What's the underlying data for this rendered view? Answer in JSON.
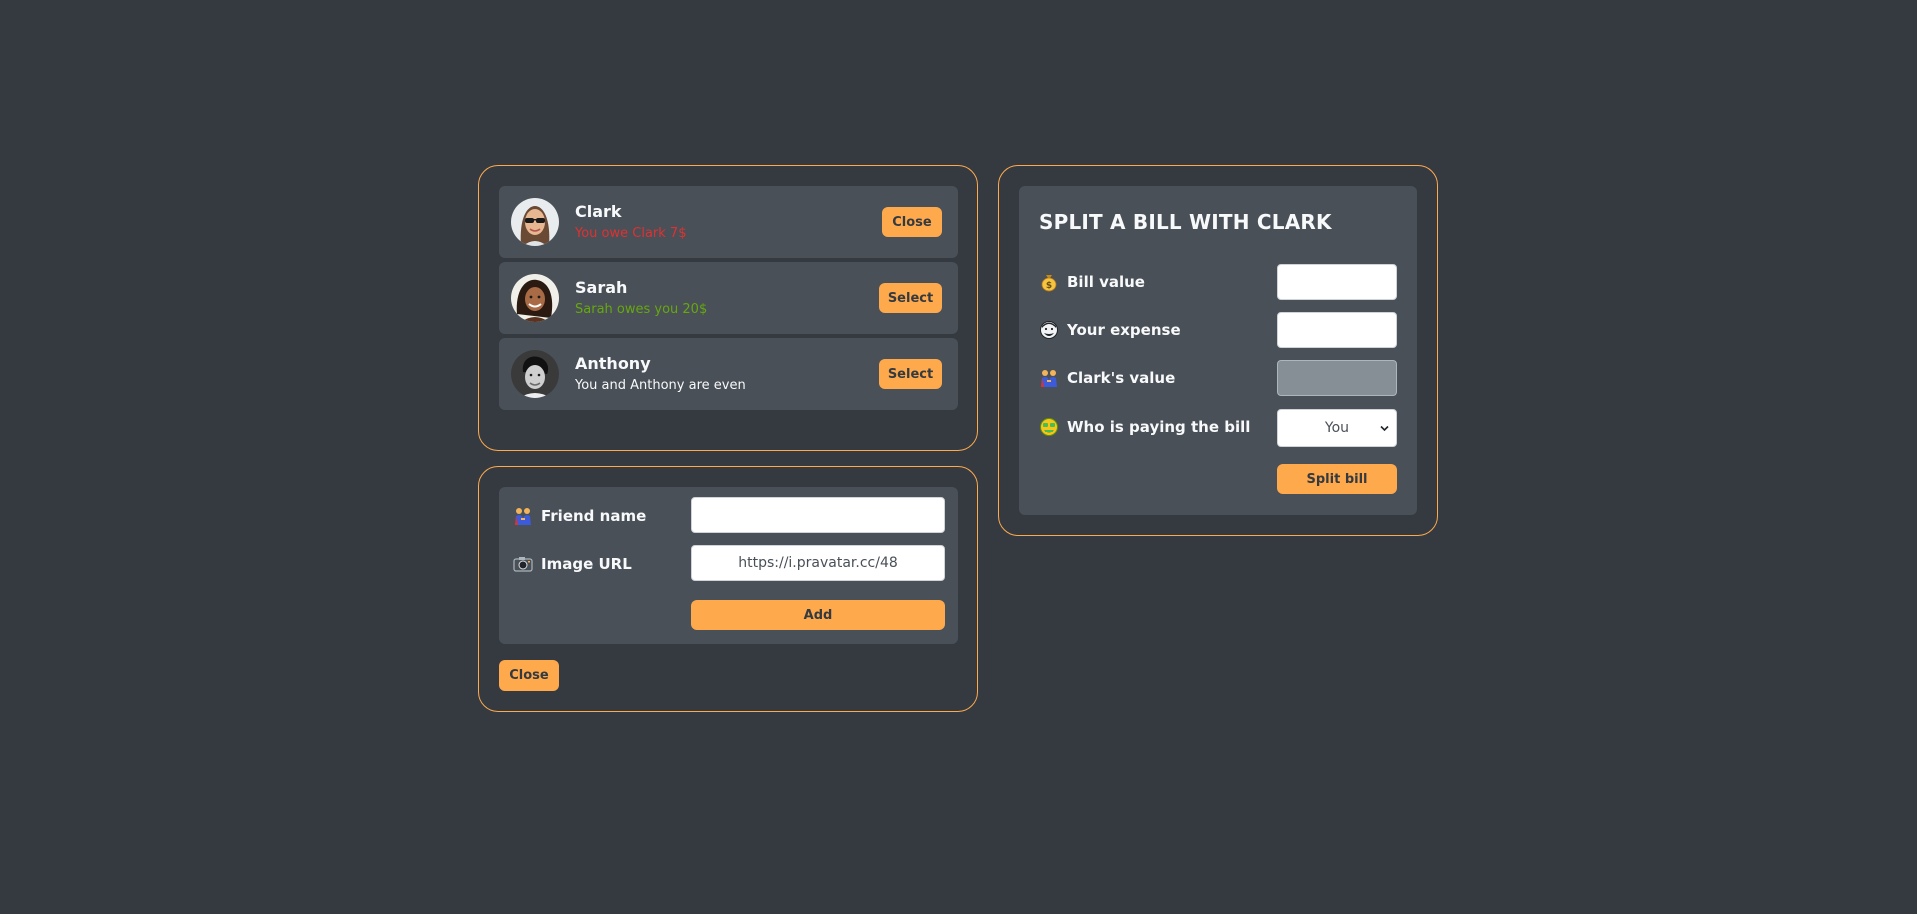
{
  "friends": [
    {
      "name": "Clark",
      "status": "You owe Clark 7$",
      "status_type": "owe",
      "button": "Close",
      "selected": true
    },
    {
      "name": "Sarah",
      "status": "Sarah owes you 20$",
      "status_type": "owed",
      "button": "Select",
      "selected": false
    },
    {
      "name": "Anthony",
      "status": "You and Anthony are even",
      "status_type": "even",
      "button": "Select",
      "selected": false
    }
  ],
  "add_friend": {
    "name_label": "Friend name",
    "name_value": "",
    "image_label": "Image URL",
    "image_value": "https://i.pravatar.cc/48",
    "add_button": "Add",
    "close_button": "Close"
  },
  "split": {
    "title": "SPLIT A BILL WITH CLARK",
    "bill_label": "Bill value",
    "bill_value": "",
    "expense_label": "Your expense",
    "expense_value": "",
    "friend_value_label": "Clark's value",
    "friend_value": "",
    "payer_label": "Who is paying the bill",
    "payer_selected": "You",
    "submit_button": "Split bill"
  },
  "colors": {
    "background": "#343a40",
    "card": "#495057",
    "accent": "#ffa94d",
    "owe": "#e03131",
    "owed": "#66a80f"
  },
  "icons": {
    "bill": "money-bag-icon",
    "expense": "man-face-icon",
    "friend_value": "people-holding-hands-icon",
    "payer": "money-face-icon",
    "friend_name": "people-holding-hands-icon",
    "image_url": "camera-icon"
  }
}
